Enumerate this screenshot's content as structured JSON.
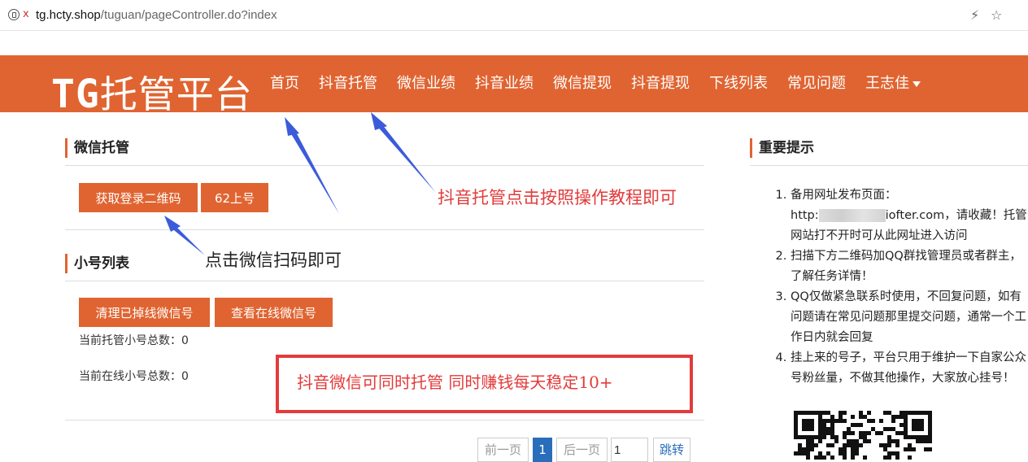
{
  "browser": {
    "url_host": "tg.hcty.shop",
    "url_path": "/tuguan/pageController.do?index",
    "insecure_icon": "x",
    "bolt_icon": "⚡",
    "star_icon": "☆"
  },
  "nav": {
    "logo_prefix": "TG",
    "logo_text": "托管平台",
    "items": [
      "首页",
      "抖音托管",
      "微信业绩",
      "抖音业绩",
      "微信提现",
      "抖音提现",
      "下线列表",
      "常见问题",
      "王志佳"
    ]
  },
  "wechat": {
    "title": "微信托管",
    "btn_qr": "获取登录二维码",
    "btn_login": "62上号"
  },
  "accounts": {
    "title": "小号列表",
    "btn_clear": "清理已掉线微信号",
    "btn_online": "查看在线微信号",
    "total_label": "当前托管小号总数：0",
    "online_label": "当前在线小号总数：0"
  },
  "annotations": {
    "douyin_hint": "抖音托管点击按照操作教程即可",
    "scan_hint": "点击微信扫码即可",
    "box_hint": "抖音微信可同时托管  同时赚钱每天稳定10+"
  },
  "pagination": {
    "prev": "前一页",
    "current": "1",
    "next": "后一页",
    "input_value": "1",
    "jump": "跳转"
  },
  "tips": {
    "title": "重要提示",
    "item1_a": "备用网址发布页面：",
    "item1_b": "http:",
    "item1_c": "iofter.com，请收藏！托管网站打不开时可从此网址进入访问",
    "item2": "扫描下方二维码加QQ群找管理员或者群主，了解任务详情！",
    "item3": "QQ仅做紧急联系时使用，不回复问题，如有问题请在常见问题那里提交问题，通常一个工作日内就会回复",
    "item4": "挂上来的号子，平台只用于维护一下自家公众号粉丝量，不做其他操作，大家放心挂号！"
  },
  "colors": {
    "brand": "#e06431",
    "annotation_red": "#e33b3b",
    "arrow_blue": "#3b5bdb"
  }
}
